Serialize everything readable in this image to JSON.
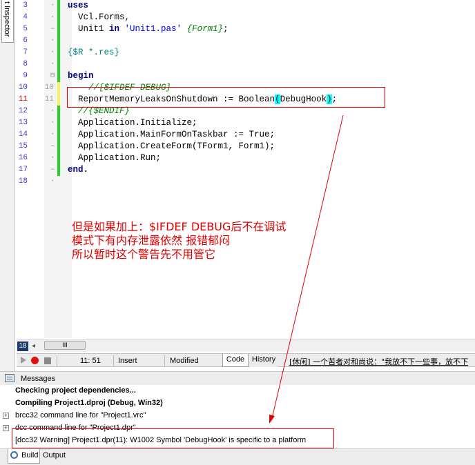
{
  "side_panel": {
    "tab_label": "t Inspector"
  },
  "editor": {
    "lines": [
      {
        "num": "3",
        "old": "",
        "fold": "·",
        "change": "green",
        "tokens": [
          {
            "t": "uses",
            "c": "kw"
          }
        ]
      },
      {
        "num": "4",
        "old": "",
        "fold": "·",
        "change": "green",
        "tokens": [
          {
            "t": "  Vcl.Forms,",
            "c": ""
          }
        ]
      },
      {
        "num": "5",
        "old": "",
        "fold": "–",
        "change": "green",
        "tokens": [
          {
            "t": "  Unit1 ",
            "c": ""
          },
          {
            "t": "in",
            "c": "kw"
          },
          {
            "t": " ",
            "c": ""
          },
          {
            "t": "'Unit1.pas'",
            "c": "str"
          },
          {
            "t": " ",
            "c": ""
          },
          {
            "t": "{Form1}",
            "c": "cmt"
          },
          {
            "t": ";",
            "c": ""
          }
        ]
      },
      {
        "num": "6",
        "old": "",
        "fold": "·",
        "change": "green",
        "tokens": []
      },
      {
        "num": "7",
        "old": "",
        "fold": "·",
        "change": "green",
        "tokens": [
          {
            "t": "{$R *.res}",
            "c": "dir"
          }
        ]
      },
      {
        "num": "8",
        "old": "",
        "fold": "·",
        "change": "green",
        "tokens": []
      },
      {
        "num": "9",
        "old": "",
        "fold": "⊟",
        "change": "green",
        "tokens": [
          {
            "t": "begin",
            "c": "kw"
          }
        ]
      },
      {
        "num": "10",
        "old": "10",
        "fold": "",
        "change": "yellow",
        "tokens": [
          {
            "t": "    //{$IFDEF DEBUG}",
            "c": "cmt"
          }
        ]
      },
      {
        "num": "11",
        "old": "11",
        "fold": "",
        "change": "yellow",
        "red": true,
        "tokens": [
          {
            "t": "  ReportMemoryLeaksOnShutdown := Boolean",
            "c": ""
          },
          {
            "t": "(",
            "c": "hl"
          },
          {
            "t": "DebugHook",
            "c": ""
          },
          {
            "t": ")",
            "c": "hl"
          },
          {
            "t": ";",
            "c": ""
          }
        ]
      },
      {
        "num": "12",
        "old": "",
        "fold": "·",
        "change": "green",
        "tokens": [
          {
            "t": "  //{$ENDIF}",
            "c": "cmt"
          }
        ]
      },
      {
        "num": "13",
        "old": "",
        "fold": "·",
        "change": "green",
        "tokens": [
          {
            "t": "  Application.Initialize;",
            "c": ""
          }
        ]
      },
      {
        "num": "14",
        "old": "",
        "fold": "·",
        "change": "green",
        "tokens": [
          {
            "t": "  Application.MainFormOnTaskbar := True;",
            "c": ""
          }
        ]
      },
      {
        "num": "15",
        "old": "",
        "fold": "–",
        "change": "green",
        "tokens": [
          {
            "t": "  Application.CreateForm(TForm1, Form1);",
            "c": ""
          }
        ]
      },
      {
        "num": "16",
        "old": "",
        "fold": "·",
        "change": "green",
        "tokens": [
          {
            "t": "  Application.Run;",
            "c": ""
          }
        ]
      },
      {
        "num": "17",
        "old": "",
        "fold": "–",
        "change": "green",
        "tokens": [
          {
            "t": "end.",
            "c": "kw"
          }
        ]
      },
      {
        "num": "18",
        "old": "",
        "fold": "·",
        "change": "none",
        "tokens": []
      }
    ],
    "annotation": "但是如果加上：$IFDEF DEBUG后不在调试\n模式下有内存泄露依然 报错郁闷\n所以暂时这个警告先不用管它",
    "scroll_position_badge": "18",
    "scroll_thumb_label": "III"
  },
  "statusbar": {
    "cursor_position": "11: 51",
    "insert_mode": "Insert",
    "modified": "Modified",
    "tab_code": "Code",
    "tab_history": "History",
    "ticker_text": "[休闲] 一个苦者对和尚说：\"我放不下一些事，放不下"
  },
  "messages": {
    "title": "Messages",
    "lines": [
      {
        "text": "Checking project dependencies...",
        "bold": true,
        "expand": false
      },
      {
        "text": "Compiling Project1.dproj (Debug, Win32)",
        "bold": true,
        "expand": false
      },
      {
        "text": "brcc32 command line for \"Project1.vrc\"",
        "bold": false,
        "expand": true
      },
      {
        "text": "dcc command line for \"Project1.dpr\"",
        "bold": false,
        "expand": true
      },
      {
        "text": "[dcc32 Warning] Project1.dpr(11): W1002 Symbol 'DebugHook' is specific to a platform",
        "bold": false,
        "expand": false
      }
    ]
  },
  "bottom_tabs": {
    "build": "Build",
    "output": "Output"
  },
  "colors": {
    "annotation_red": "#e00000",
    "change_green": "#23d323",
    "change_yellow": "#f4f460",
    "bracket_highlight": "#00ffff"
  }
}
